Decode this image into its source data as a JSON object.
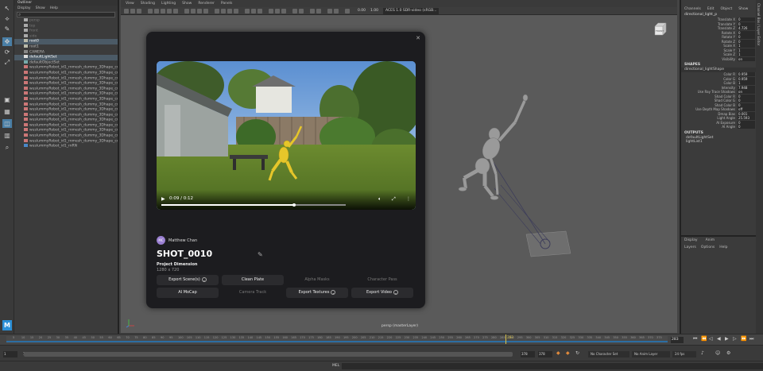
{
  "outliner": {
    "title": "Outliner",
    "menu": [
      "Display",
      "Show",
      "Help"
    ],
    "rows": [
      {
        "label": "persp",
        "type": "camera",
        "dim": true
      },
      {
        "label": "top",
        "type": "camera",
        "dim": true
      },
      {
        "label": "front",
        "type": "camera",
        "dim": true
      },
      {
        "label": "side",
        "type": "camera",
        "dim": true
      },
      {
        "label": "root0",
        "type": "joint",
        "sel": true
      },
      {
        "label": "root1",
        "type": "joint"
      },
      {
        "label": "CAMERA",
        "type": "group"
      },
      {
        "label": "defaultLightSet",
        "type": "light",
        "sel": true
      },
      {
        "label": "defaultObjectSet",
        "type": "set"
      },
      {
        "label": "wuslummyRobot_id1_rnmesh_dummy_3Dhape_createSet1",
        "type": "mesh"
      },
      {
        "label": "wuslummyRobot_id1_rnmesh_dummy_3Dhape_createSet2",
        "type": "mesh"
      },
      {
        "label": "wuslummyRobot_id1_rnmesh_dummy_3Dhape_createSet3",
        "type": "mesh"
      },
      {
        "label": "wuslummyRobot_id1_rnmesh_dummy_3Dhape_createSet4",
        "type": "mesh"
      },
      {
        "label": "wuslummyRobot_id1_rnmesh_dummy_3Dhape_createSet5",
        "type": "mesh"
      },
      {
        "label": "wuslummyRobot_id1_rnmesh_dummy_3Dhape_createSet6",
        "type": "mesh"
      },
      {
        "label": "wuslummyRobot_id1_rnmesh_dummy_3Dhape_createSet7",
        "type": "mesh"
      },
      {
        "label": "wuslummyRobot_id1_rnmesh_dummy_3Dhape_createSet8",
        "type": "mesh"
      },
      {
        "label": "wuslummyRobot_id1_rnmesh_dummy_3Dhape_createSet9",
        "type": "mesh"
      },
      {
        "label": "wuslummyRobot_id1_rnmesh_dummy_3Dhape_createSet10",
        "type": "mesh"
      },
      {
        "label": "wuslummyRobot_id1_rnmesh_dummy_3Dhape_createSet11",
        "type": "mesh"
      },
      {
        "label": "wuslummyRobot_id1_rnmesh_dummy_3Dhape_createSet12",
        "type": "mesh"
      },
      {
        "label": "wuslummyRobot_id1_rnmesh_dummy_3Dhape_createSet13",
        "type": "mesh"
      },
      {
        "label": "wuslummyRobot_id1_rnmesh_dummy_3Dhape_createSet14",
        "type": "mesh"
      },
      {
        "label": "wuslummyRobot_id1_rnmesh_dummy_3Dhape_createSet15",
        "type": "mesh"
      },
      {
        "label": "wuslummyRobot_id1_rnRN",
        "type": "ref"
      }
    ]
  },
  "panel_menu": [
    "View",
    "Shading",
    "Lighting",
    "Show",
    "Renderer",
    "Panels"
  ],
  "toolbar": {
    "num1": "0.00",
    "num2": "1.00",
    "color_space": "ACES 1.0 SDR-video (sRGB..."
  },
  "viewport": {
    "camera_label": "persp (masterLayer)",
    "cube_label": "FRONT"
  },
  "modal": {
    "video_time": "0:09 / 0:12",
    "video_progress": 0.72,
    "author_initials": "MC",
    "author_name": "Matthew Chan",
    "shot_title": "SHOT_0010",
    "dimension_label": "Project Dimension",
    "dimension_value": "1280 x 720",
    "buttons": [
      {
        "label": "Export Scene(s)",
        "chevron": true,
        "disabled": false
      },
      {
        "label": "Clean Plate",
        "chevron": false,
        "disabled": false
      },
      {
        "label": "Alpha Masks",
        "chevron": false,
        "disabled": true
      },
      {
        "label": "Character Pass",
        "chevron": false,
        "disabled": true
      },
      {
        "label": "AI MoCap",
        "chevron": false,
        "disabled": false
      },
      {
        "label": "Camera Track",
        "chevron": false,
        "disabled": true
      },
      {
        "label": "Export Textures",
        "chevron": true,
        "disabled": false
      },
      {
        "label": "Export Video",
        "chevron": true,
        "disabled": false
      }
    ]
  },
  "channel_box": {
    "tabs": [
      "Channels",
      "Edit",
      "Object",
      "Show"
    ],
    "node": "directional_light_p",
    "transform": [
      {
        "label": "Translate X",
        "value": "0"
      },
      {
        "label": "Translate Y",
        "value": "0"
      },
      {
        "label": "Translate Z",
        "value": "4.726"
      },
      {
        "label": "Rotate X",
        "value": "0"
      },
      {
        "label": "Rotate Y",
        "value": "0"
      },
      {
        "label": "Rotate Z",
        "value": "0"
      },
      {
        "label": "Scale X",
        "value": "1"
      },
      {
        "label": "Scale Y",
        "value": "1"
      },
      {
        "label": "Scale Z",
        "value": "1"
      },
      {
        "label": "Visibility",
        "value": "on"
      }
    ],
    "shapes_title": "SHAPES",
    "shape_node": "directional_lightShape",
    "shape_attrs": [
      {
        "label": "Color R",
        "value": "0.959"
      },
      {
        "label": "Color G",
        "value": "0.959"
      },
      {
        "label": "Color B",
        "value": "1"
      },
      {
        "label": "Intensity",
        "value": "7.948"
      },
      {
        "label": "Use Ray Trace Shadows",
        "value": "on"
      },
      {
        "label": "Shad Color R",
        "value": "0"
      },
      {
        "label": "Shad Color G",
        "value": "0"
      },
      {
        "label": "Shad Color B",
        "value": "0"
      },
      {
        "label": "Use Depth Map Shadows",
        "value": "off"
      },
      {
        "label": "Dmap Bias",
        "value": "0.001"
      },
      {
        "label": "Light Angle",
        "value": "25.593"
      },
      {
        "label": "AI Exposure",
        "value": "0"
      },
      {
        "label": "AI Angle",
        "value": "0"
      }
    ],
    "outputs_title": "OUTPUTS",
    "outputs": [
      "defaultLightSet",
      "lightList1"
    ],
    "side_tab": "Channel Box / Layer Editor"
  },
  "layer_editor": {
    "tabs": [
      "Display",
      "Anim"
    ],
    "menu": [
      "Layers",
      "Options",
      "Help"
    ]
  },
  "timeline": {
    "ticks": [
      "5",
      "10",
      "15",
      "20",
      "25",
      "30",
      "35",
      "40",
      "45",
      "50",
      "55",
      "60",
      "65",
      "70",
      "75",
      "80",
      "85",
      "90",
      "95",
      "100",
      "105",
      "110",
      "115",
      "120",
      "125",
      "130",
      "135",
      "140",
      "145",
      "150",
      "155",
      "160",
      "165",
      "170",
      "175",
      "180",
      "185",
      "190",
      "195",
      "200",
      "205",
      "210",
      "215",
      "220",
      "225",
      "230",
      "235",
      "240",
      "245",
      "250",
      "255",
      "260",
      "265",
      "270",
      "275",
      "280",
      "285",
      "290",
      "295",
      "300",
      "305",
      "310",
      "315",
      "320",
      "325",
      "330",
      "335",
      "340",
      "345",
      "350",
      "355",
      "360",
      "365",
      "370",
      "375"
    ],
    "current": "283",
    "current_fraction": 0.755
  },
  "range": {
    "start": "1",
    "start2": "1",
    "end": "378",
    "end2": "378",
    "character_set": "No Character Set",
    "anim_layer": "No Anim Layer",
    "fps": "24 fps"
  },
  "cmdline": {
    "label": "MEL"
  }
}
